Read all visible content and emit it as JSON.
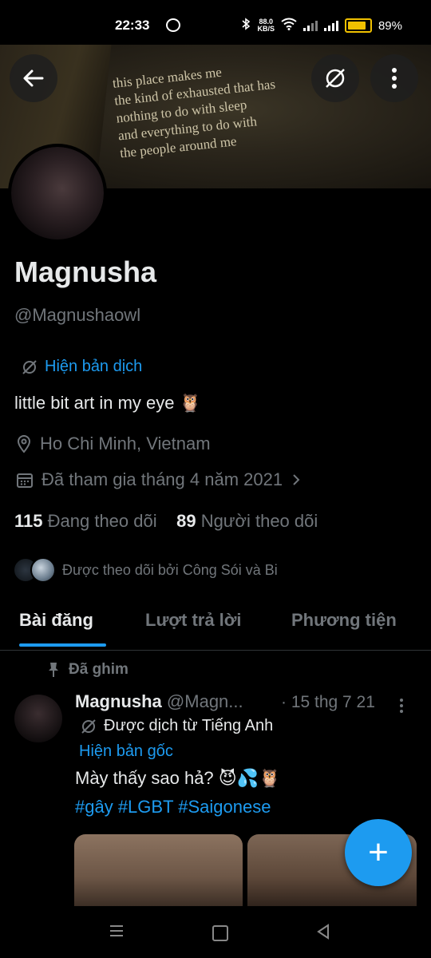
{
  "status_bar": {
    "time": "22:33",
    "net_speed": "88.0",
    "net_unit": "KB/S",
    "battery": "89%"
  },
  "banner": {
    "quote_lines": [
      "this place makes me",
      "the kind of exhausted that has",
      "nothing to do with sleep",
      "and everything to do with",
      "the people around me"
    ]
  },
  "profile": {
    "name": "Magnusha",
    "handle": "@Magnushaowl",
    "show_translation": "Hiện bản dịch",
    "bio": "little bit art in my eye 🦉",
    "location": "Ho Chi Minh, Vietnam",
    "joined": "Đã tham gia tháng 4 năm 2021",
    "following_count": "115",
    "following_label": "Đang theo dõi",
    "followers_count": "89",
    "followers_label": "Người theo dõi",
    "followed_by": "Được theo dõi bởi Công Sói và Bi"
  },
  "tabs": [
    {
      "label": "Bài đăng"
    },
    {
      "label": "Lượt trả lời"
    },
    {
      "label": "Phương tiện"
    }
  ],
  "post": {
    "pinned_label": "Đã ghim",
    "author_name": "Magnusha",
    "author_handle": "@Magn...",
    "date": "· 15 thg 7 21",
    "translated_from": "Được dịch từ Tiếng Anh",
    "show_original": "Hiện bản gốc",
    "text": "Mày thấy sao hả? 😈💦🦉",
    "hashtags": "#gây #LGBT #Saigonese"
  },
  "fab": {
    "label": "+"
  },
  "colors": {
    "accent": "#1d9bf0",
    "background": "#000000",
    "secondary_text": "#71767b"
  }
}
